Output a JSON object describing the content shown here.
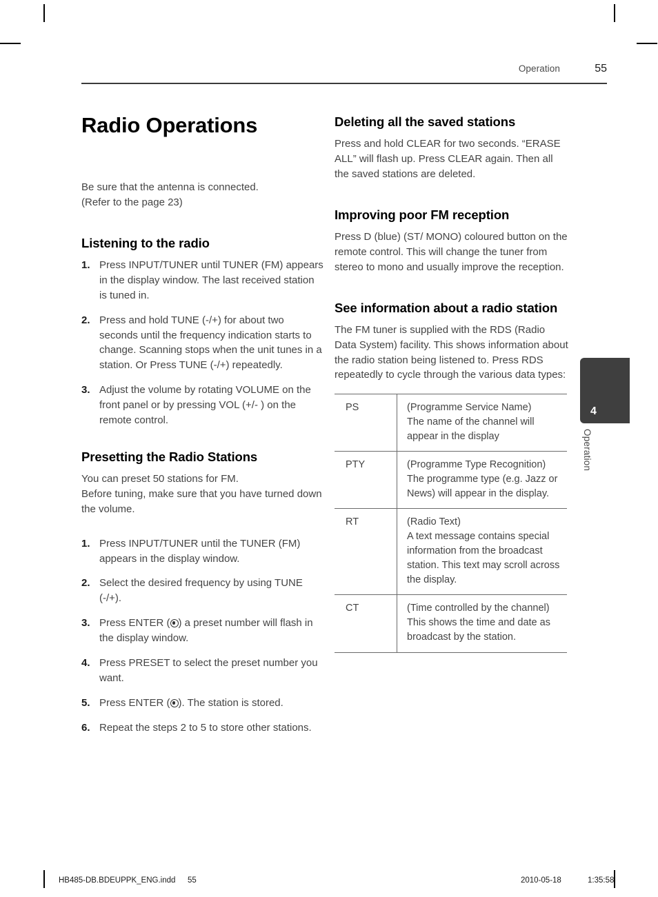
{
  "header": {
    "section": "Operation",
    "page_number": "55"
  },
  "left_column": {
    "title": "Radio Operations",
    "intro": "Be sure that the antenna is connected.\n(Refer to the page 23)",
    "section1": {
      "heading": "Listening to the radio",
      "steps": [
        {
          "num": "1.",
          "text": "Press INPUT/TUNER until TUNER (FM) appears in the display window. The last received station is tuned in."
        },
        {
          "num": "2.",
          "text": "Press and hold TUNE (-/+) for about two seconds until the frequency indication starts to change. Scanning stops when the unit tunes in a station. Or Press TUNE (-/+) repeatedly."
        },
        {
          "num": "3.",
          "text": "Adjust the volume by rotating VOLUME on the front panel or by pressing VOL (+/- ) on the remote control."
        }
      ]
    },
    "section2": {
      "heading": "Presetting the Radio Stations",
      "intro": "You can preset 50 stations for FM.\nBefore tuning, make sure that you have turned down the volume.",
      "steps": [
        {
          "num": "1.",
          "text": "Press INPUT/TUNER until the TUNER (FM) appears in the display window."
        },
        {
          "num": "2.",
          "text": "Select the desired frequency by using TUNE (-/+)."
        },
        {
          "num": "3.",
          "pre": "Press ENTER (",
          "post": ") a preset number will flash in the display window."
        },
        {
          "num": "4.",
          "text": "Press PRESET to select the preset number you want."
        },
        {
          "num": "5.",
          "pre": "Press ENTER (",
          "post": "). The station is stored."
        },
        {
          "num": "6.",
          "text": "Repeat the steps 2 to 5 to store other stations."
        }
      ]
    }
  },
  "right_column": {
    "section1": {
      "heading": "Deleting all the saved stations",
      "body": "Press and hold CLEAR for two seconds. “ERASE ALL” will flash up. Press CLEAR again. Then all the saved stations are deleted."
    },
    "section2": {
      "heading": "Improving poor FM reception",
      "body": "Press D (blue) (ST/ MONO) coloured button on the remote control. This will change the tuner from stereo to mono and usually improve the reception."
    },
    "section3": {
      "heading": "See information about a radio station",
      "body": "The FM tuner is supplied with the RDS (Radio Data System) facility. This shows information about the radio station being listened to. Press RDS repeatedly to cycle through the various data types:",
      "table": {
        "rows": [
          {
            "key": "PS",
            "value": "(Programme Service Name)\nThe name of the channel will appear in the display"
          },
          {
            "key": "PTY",
            "value": "(Programme Type Recognition)\nThe programme type (e.g. Jazz or News) will appear in the display."
          },
          {
            "key": "RT",
            "value": "(Radio Text)\nA text message contains special information from the broadcast station. This text may scroll across the display."
          },
          {
            "key": "CT",
            "value": "(Time controlled by the channel)\nThis shows the time and date as broadcast by the station."
          }
        ]
      }
    }
  },
  "side_tab": {
    "number": "4",
    "label": "Operation",
    "color": "#3f3f3f"
  },
  "footer": {
    "file": "HB485-DB.BDEUPPK_ENG.indd",
    "page": "55",
    "date": "2010-05-18",
    "time": "1:35:58"
  }
}
